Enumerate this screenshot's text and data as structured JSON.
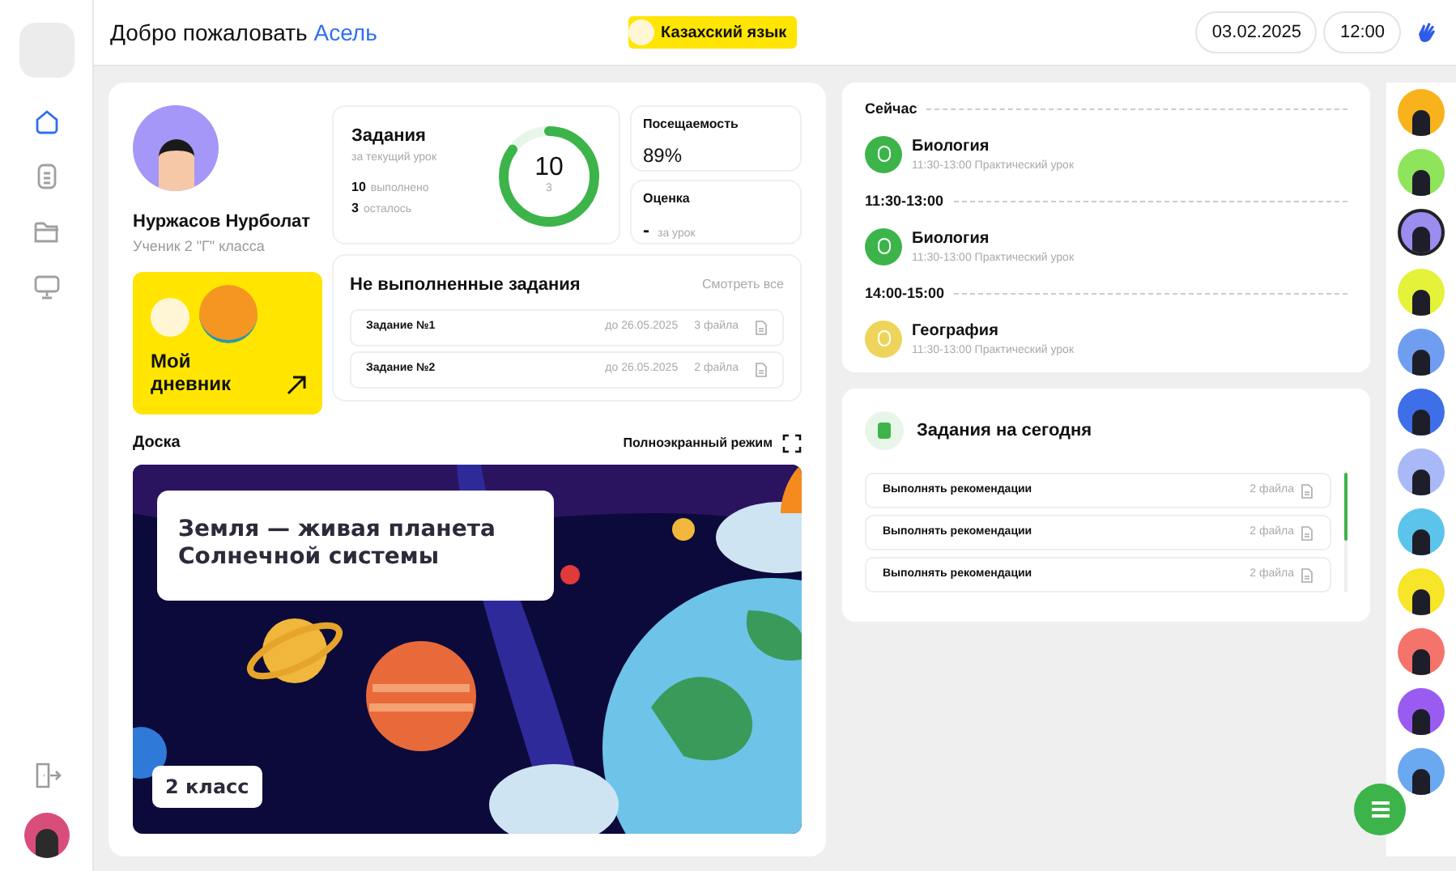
{
  "header": {
    "greeting": "Добро пожаловать",
    "user_name": "Асель",
    "language": "Казахский язык",
    "date": "03.02.2025",
    "time": "12:00"
  },
  "sidebar": {
    "items": [
      {
        "kind": "home",
        "selected": true
      },
      {
        "kind": "list",
        "selected": false
      },
      {
        "kind": "folder",
        "selected": false
      },
      {
        "kind": "board",
        "selected": false
      }
    ]
  },
  "profile": {
    "name": "Нуржасов Нурболат",
    "subtitle": "Ученик 2 \"Г\" класса"
  },
  "diary": {
    "label": "Мой дневник"
  },
  "tasks_card": {
    "title": "Задания",
    "subtitle": "за текущий урок",
    "done_count": "10",
    "done_label": "выполнено",
    "left_count": "3",
    "left_label": "осталось",
    "ring_value": "10",
    "ring_sub": "3",
    "level": 0.85
  },
  "attendance": {
    "title": "Посещаемость",
    "value": "89%"
  },
  "grade": {
    "title": "Оценка",
    "value": "-",
    "note": "за урок"
  },
  "pending": {
    "title": "Не выполненные задания",
    "link": "Смотреть все",
    "rows": [
      {
        "name": "Задание №1",
        "due": "до 26.05.2025",
        "files": "3 файла"
      },
      {
        "name": "Задание №2",
        "due": "до 26.05.2025",
        "files": "2 файла"
      }
    ]
  },
  "board": {
    "title": "Доска",
    "fullscreen": "Полноэкранный режим",
    "slide_title": "Земля — живая планета Солнечной системы",
    "grade_badge": "2 класс"
  },
  "schedule": [
    {
      "heading": "Сейчас",
      "subject": "Биология",
      "details": "11:30-13:00 Практический урок",
      "color": "#3cb44a"
    },
    {
      "heading": "11:30-13:00",
      "subject": "Биология",
      "details": "11:30-13:00 Практический урок",
      "color": "#3cb44a"
    },
    {
      "heading": "14:00-15:00",
      "subject": "География",
      "details": "11:30-13:00 Практический урок",
      "color": "#eed45a"
    }
  ],
  "today": {
    "title": "Задания на сегодня",
    "rows": [
      {
        "name": "Выполнять рекомендации",
        "files": "2 файла"
      },
      {
        "name": "Выполнять рекомендации",
        "files": "2 файла"
      },
      {
        "name": "Выполнять рекомендации",
        "files": "2 файла"
      }
    ]
  },
  "classmates": [
    {
      "color": "#f8b31c",
      "selected": false
    },
    {
      "color": "#8ee45a",
      "selected": false
    },
    {
      "color": "#9b8cf0",
      "selected": true
    },
    {
      "color": "#e4f23a",
      "selected": false
    },
    {
      "color": "#6f9df0",
      "selected": false
    },
    {
      "color": "#3f6fe8",
      "selected": false
    },
    {
      "color": "#a9b8f6",
      "selected": false
    },
    {
      "color": "#5cc4ea",
      "selected": false
    },
    {
      "color": "#f6e528",
      "selected": false
    },
    {
      "color": "#f4736a",
      "selected": false
    },
    {
      "color": "#9a5cf0",
      "selected": false
    },
    {
      "color": "#6aa8f0",
      "selected": false
    }
  ]
}
